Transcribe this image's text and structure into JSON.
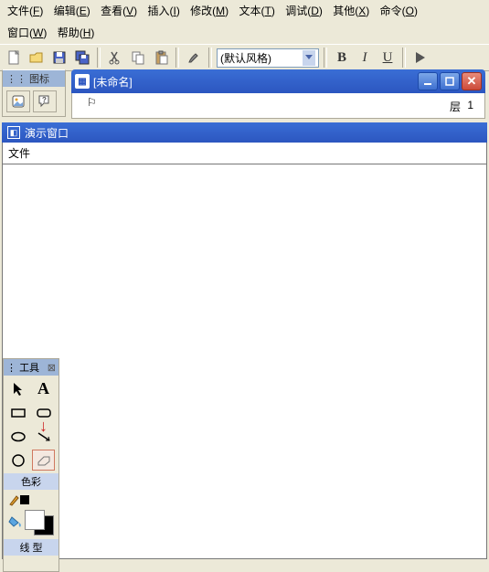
{
  "menu": {
    "row1": [
      {
        "label": "文件",
        "key": "F"
      },
      {
        "label": "编辑",
        "key": "E"
      },
      {
        "label": "查看",
        "key": "V"
      },
      {
        "label": "插入",
        "key": "I"
      },
      {
        "label": "修改",
        "key": "M"
      },
      {
        "label": "文本",
        "key": "T"
      },
      {
        "label": "调试",
        "key": "D"
      },
      {
        "label": "其他",
        "key": "X"
      },
      {
        "label": "命令",
        "key": "O"
      }
    ],
    "row2": [
      {
        "label": "窗口",
        "key": "W"
      },
      {
        "label": "帮助",
        "key": "H"
      }
    ]
  },
  "toolbar": {
    "style_combo": "(默认风格)",
    "bold": "B",
    "italic": "I",
    "underline": "U"
  },
  "panels": {
    "icons_title": "图标",
    "tools_title": "工具",
    "color_title": "色彩",
    "line_title": "线 型"
  },
  "child": {
    "title": "[未命名]",
    "layer_label": "层",
    "layer_num": "1"
  },
  "demo": {
    "title": "演示窗口",
    "menu_file": "文件"
  },
  "tools_text_A": "A"
}
